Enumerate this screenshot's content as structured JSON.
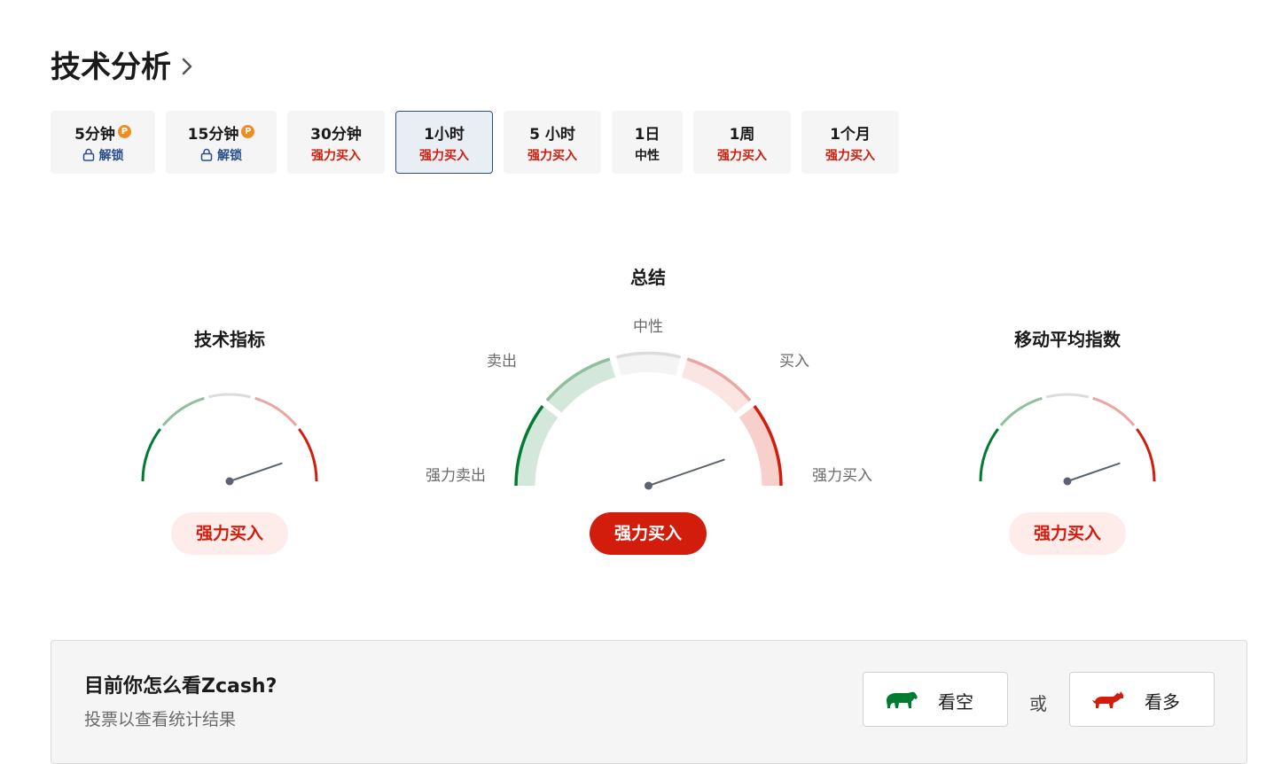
{
  "header": {
    "title": "技术分析"
  },
  "timeframes": [
    {
      "label": "5分钟",
      "premium": true,
      "status": "解锁",
      "status_type": "locked"
    },
    {
      "label": "15分钟",
      "premium": true,
      "status": "解锁",
      "status_type": "locked"
    },
    {
      "label": "30分钟",
      "premium": false,
      "status": "强力买入",
      "status_type": "buy"
    },
    {
      "label": "1小时",
      "premium": false,
      "status": "强力买入",
      "status_type": "buy",
      "active": true
    },
    {
      "label": "5 小时",
      "premium": false,
      "status": "强力买入",
      "status_type": "buy"
    },
    {
      "label": "1日",
      "premium": false,
      "status": "中性",
      "status_type": "neutral"
    },
    {
      "label": "1周",
      "premium": false,
      "status": "强力买入",
      "status_type": "buy"
    },
    {
      "label": "1个月",
      "premium": false,
      "status": "强力买入",
      "status_type": "buy"
    }
  ],
  "premium_badge": "P",
  "gauges": {
    "indicators": {
      "title": "技术指标",
      "result": "强力买入"
    },
    "summary": {
      "title": "总结",
      "result": "强力买入",
      "labels": {
        "strong_sell": "强力卖出",
        "sell": "卖出",
        "neutral": "中性",
        "buy": "买入",
        "strong_buy": "强力买入"
      }
    },
    "moving_averages": {
      "title": "移动平均指数",
      "result": "强力买入"
    }
  },
  "gauge_needle_angle_deg": 19,
  "poll": {
    "question": "目前你怎么看Zcash?",
    "subtitle": "投票以查看统计结果",
    "bearish_label": "看空",
    "or_label": "或",
    "bullish_label": "看多"
  },
  "colors": {
    "buy_red": "#d21c0c",
    "sell_green": "#007c32",
    "link_blue": "#2a4e8c",
    "premium_orange": "#f18d1f"
  },
  "icons": {
    "title_chevron": "chevron-right-icon",
    "lock": "lock-icon",
    "bear": "bear-icon",
    "bull": "bull-icon"
  }
}
